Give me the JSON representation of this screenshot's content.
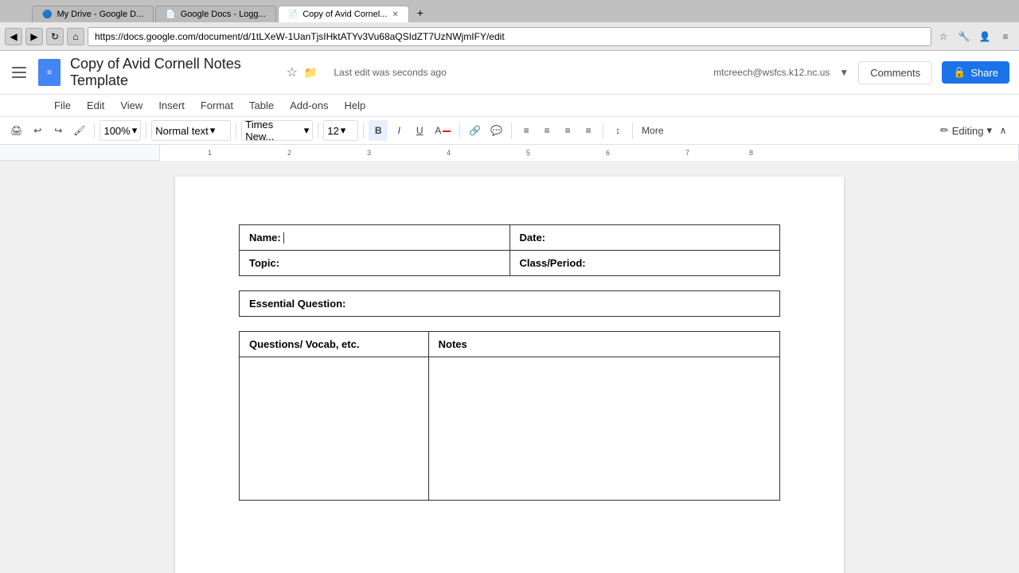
{
  "browser": {
    "tabs": [
      {
        "id": "tab1",
        "label": "My Drive - Google D...",
        "active": false
      },
      {
        "id": "tab2",
        "label": "Google Docs - Logg...",
        "active": false
      },
      {
        "id": "tab3",
        "label": "Copy of Avid Cornel...",
        "active": true
      }
    ],
    "url": "https://docs.google.com/document/d/1tLXeW-1UanTjsIHktATYv3Vu68aQSIdZT7UzNWjmIFY/edit",
    "nav_back": "◀",
    "nav_forward": "▶",
    "nav_refresh": "↻",
    "nav_home": "⌂"
  },
  "header": {
    "title": "Copy of Avid Cornell Notes Template",
    "last_edit": "Last edit was seconds ago",
    "user_email": "mtcreech@wsfcs.k12.nc.us",
    "comments_label": "Comments",
    "share_label": "Share"
  },
  "menu": {
    "items": [
      "File",
      "Edit",
      "View",
      "Insert",
      "Format",
      "Table",
      "Add-ons",
      "Help"
    ]
  },
  "toolbar": {
    "zoom": "100%",
    "style": "Normal text",
    "font": "Times New...",
    "size": "12",
    "bold": "B",
    "italic": "I",
    "underline": "U",
    "more": "More",
    "editing": "Editing"
  },
  "doc": {
    "name_label": "Name:",
    "date_label": "Date:",
    "topic_label": "Topic:",
    "class_label": "Class/Period:",
    "essential_label": "Essential Question:",
    "questions_label": "Questions/ Vocab, etc.",
    "notes_label": "Notes"
  }
}
